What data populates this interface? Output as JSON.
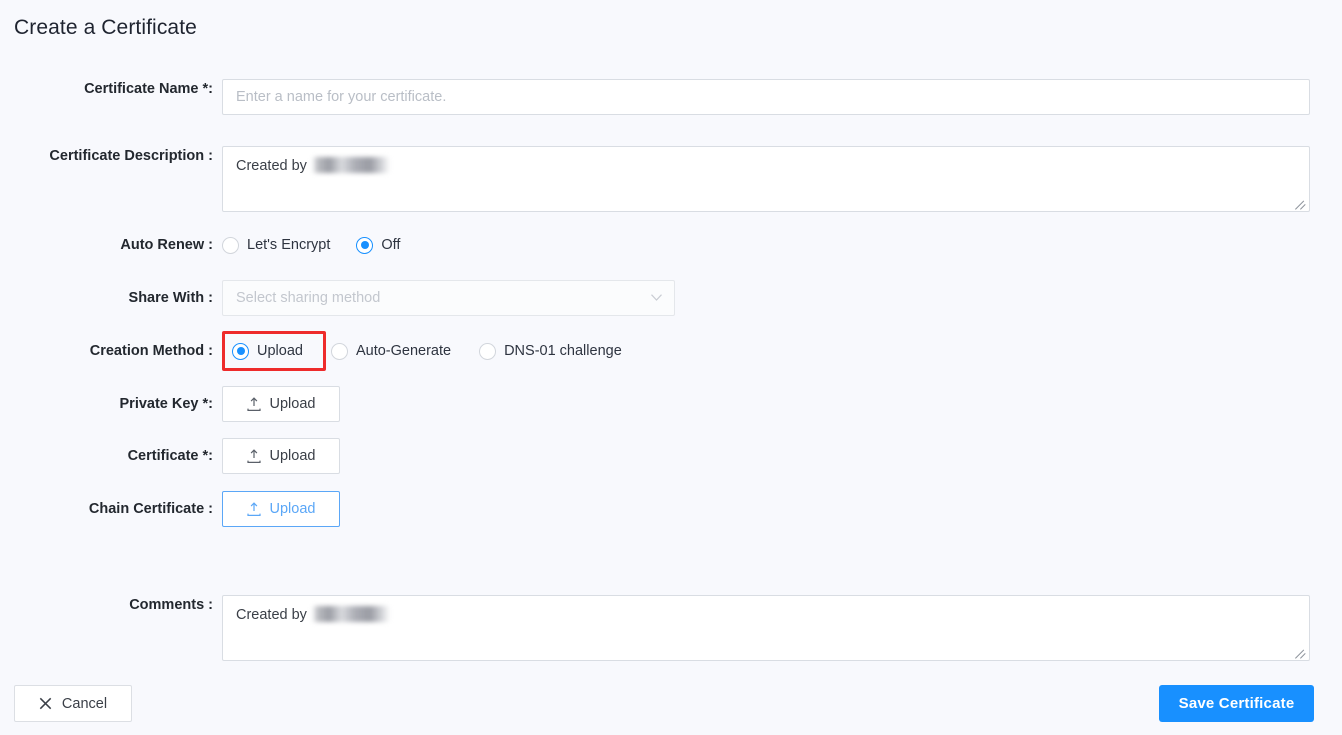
{
  "page": {
    "title": "Create a Certificate",
    "background_color": "#f8f9fd",
    "accent_color": "#1890ff",
    "highlight_color": "#ee2b2b"
  },
  "fields": {
    "certificate_name": {
      "label": "Certificate Name *:",
      "value": "",
      "placeholder": "Enter a name for your certificate."
    },
    "certificate_description": {
      "label": "Certificate Description :",
      "value": "Created by",
      "redacted_suffix": true
    },
    "auto_renew": {
      "label": "Auto Renew :",
      "options": [
        {
          "label": "Let's Encrypt",
          "checked": false
        },
        {
          "label": "Off",
          "checked": true
        }
      ]
    },
    "share_with": {
      "label": "Share With :",
      "value": "",
      "placeholder": "Select sharing method",
      "arrow_icon": "chevron-down-icon"
    },
    "creation_method": {
      "label": "Creation Method :",
      "options": [
        {
          "label": "Upload",
          "checked": true,
          "highlighted": true
        },
        {
          "label": "Auto-Generate",
          "checked": false,
          "highlighted": false
        },
        {
          "label": "DNS-01 challenge",
          "checked": false,
          "highlighted": false
        }
      ]
    },
    "private_key": {
      "label": "Private Key *:",
      "button_label": "Upload",
      "icon": "upload-icon",
      "state": "default"
    },
    "certificate": {
      "label": "Certificate *:",
      "button_label": "Upload",
      "icon": "upload-icon",
      "state": "default"
    },
    "chain_certificate": {
      "label": "Chain Certificate :",
      "button_label": "Upload",
      "icon": "upload-icon",
      "state": "hovered"
    },
    "comments": {
      "label": "Comments :",
      "value": "Created by",
      "redacted_suffix": true
    }
  },
  "footer": {
    "cancel_label": "Cancel",
    "cancel_icon": "close-x-icon",
    "save_label": "Save Certificate"
  }
}
